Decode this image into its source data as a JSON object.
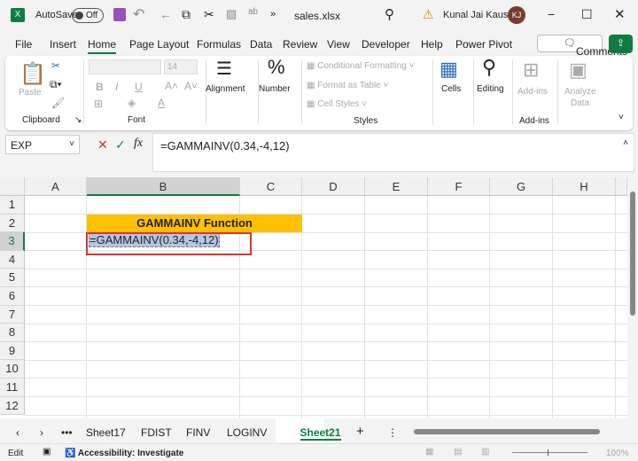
{
  "titlebar": {
    "autosave": "AutoSave",
    "toggle": "Off",
    "filename": "sales.xlsx",
    "user": "Kunal Jai Kaushik",
    "initials": "KJ"
  },
  "menu": [
    "File",
    "Insert",
    "Home",
    "Page Layout",
    "Formulas",
    "Data",
    "Review",
    "View",
    "Developer",
    "Help",
    "Power Pivot"
  ],
  "comments": "Comments",
  "ribbon": {
    "paste": "Paste",
    "clipboard": "Clipboard",
    "font_size": "14",
    "font": "Font",
    "alignment": "Alignment",
    "number": "Number",
    "cond_fmt": "Conditional Formatting",
    "fmt_table": "Format as Table",
    "cell_styles": "Cell Styles",
    "styles": "Styles",
    "cells": "Cells",
    "editing": "Editing",
    "addins": "Add-ins",
    "addins_group": "Add-ins",
    "analyze": "Analyze",
    "analyze2": "Data"
  },
  "formula_bar": {
    "name_box": "EXP",
    "formula": "=GAMMAINV(0.34,-4,12)"
  },
  "columns": [
    "A",
    "B",
    "C",
    "D",
    "E",
    "F",
    "G",
    "H"
  ],
  "rows": [
    "1",
    "2",
    "3",
    "4",
    "5",
    "6",
    "7",
    "8",
    "9",
    "10",
    "11",
    "12"
  ],
  "cells": {
    "B2": "GAMMAINV Function",
    "B3": "=GAMMAINV(0.34,-4,12)"
  },
  "colors": {
    "header_fill": "#ffc000",
    "accent": "#107c41",
    "selection": "#e03030"
  },
  "sheets": [
    "Sheet17",
    "FDIST",
    "FINV",
    "LOGINV",
    "Sheet21"
  ],
  "active_sheet": "Sheet21",
  "status": {
    "mode": "Edit",
    "accessibility": "Accessibility: Investigate",
    "zoom": "100%"
  }
}
